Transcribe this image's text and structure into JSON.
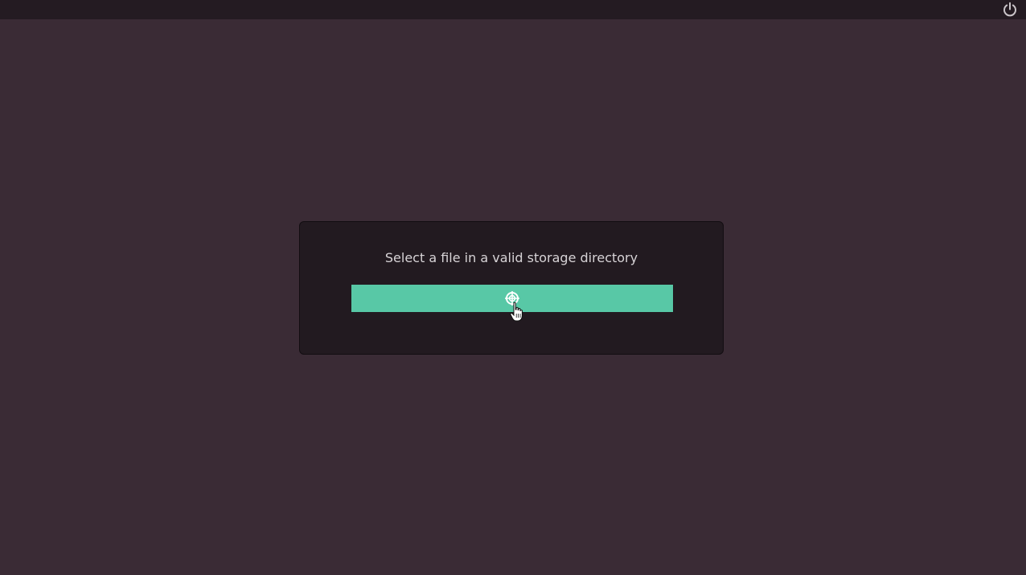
{
  "topbar": {
    "power_icon": "power-icon"
  },
  "dialog": {
    "message": "Select a file in a valid storage directory",
    "button_icon": "crosshair-target-icon",
    "button_color": "#58c8a6"
  },
  "colors": {
    "background": "#3a2b35",
    "topbar": "#241b22",
    "dialog": "#221a20",
    "text": "#d7d3d6"
  }
}
